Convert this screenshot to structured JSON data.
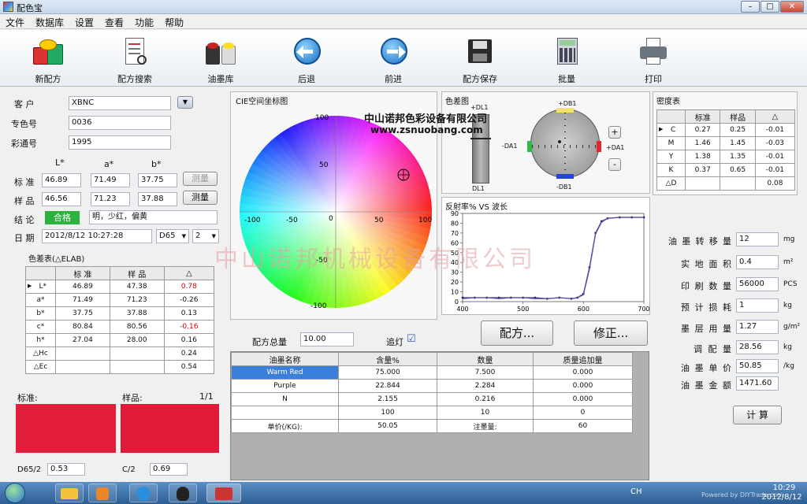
{
  "window": {
    "title": "配色宝"
  },
  "menu": [
    "文件",
    "数据库",
    "设置",
    "查看",
    "功能",
    "帮助"
  ],
  "toolbar": [
    {
      "label": "新配方",
      "icon": "paint-cans-icon"
    },
    {
      "label": "配方搜索",
      "icon": "document-search-icon"
    },
    {
      "label": "油墨库",
      "icon": "ink-library-icon"
    },
    {
      "label": "后退",
      "icon": "arrow-left-icon"
    },
    {
      "label": "前进",
      "icon": "arrow-right-icon"
    },
    {
      "label": "配方保存",
      "icon": "floppy-save-icon"
    },
    {
      "label": "批量",
      "icon": "calculator-icon"
    },
    {
      "label": "打印",
      "icon": "printer-icon"
    }
  ],
  "form": {
    "customer_label": "客 户",
    "customer": "XBNC",
    "color_no_label": "专色号",
    "color_no": "0036",
    "pantone_label": "彩通号",
    "pantone": "1995",
    "lab_headers": [
      "L*",
      "a*",
      "b*"
    ],
    "standard_label": "标 准",
    "standard": [
      "46.89",
      "71.49",
      "37.75"
    ],
    "sample_label": "样 品",
    "sample": [
      "46.56",
      "71.23",
      "37.88"
    ],
    "measure1": "测量",
    "measure2": "测量",
    "conclusion_label": "结 论",
    "conclusion_badge": "合格",
    "conclusion_text": "明，少红，偏黄",
    "date_label": "日 期",
    "date": "2012/8/12 10:27:28",
    "illuminant": "D65",
    "observer": "2"
  },
  "diff_table": {
    "title": "色差表(△ELAB)",
    "headers": [
      "",
      "标 准",
      "样 品",
      "△"
    ],
    "rows": [
      [
        "L*",
        "46.89",
        "47.38",
        "0.78"
      ],
      [
        "a*",
        "71.49",
        "71.23",
        "-0.26"
      ],
      [
        "b*",
        "37.75",
        "37.88",
        "0.13"
      ],
      [
        "c*",
        "80.84",
        "80.56",
        "-0.16"
      ],
      [
        "h*",
        "27.04",
        "28.00",
        "0.16"
      ],
      [
        "△Hc",
        "",
        "",
        "0.24"
      ],
      [
        "△Ec",
        "",
        "",
        "0.54"
      ]
    ]
  },
  "swatches": {
    "standard_label": "标准:",
    "sample_label": "样品:",
    "page": "1/1",
    "standard_color": "#e31e3c",
    "sample_color": "#e01a38",
    "bottom_left_label": "D65/2",
    "bottom_left_value": "0.53",
    "bottom_right_label": "C/2",
    "bottom_right_value": "0.69"
  },
  "cie": {
    "title": "CIE空间坐标图",
    "ticks_x": [
      "-100",
      "-50",
      "50",
      "100"
    ],
    "ticks_y": [
      "100",
      "50",
      "-50",
      "-100"
    ],
    "zero": "0"
  },
  "color_diff": {
    "title": "色差图",
    "dl_plus": "+DL1",
    "dl_minus": "DL1",
    "db_plus": "+DB1",
    "db_minus": "-DB1",
    "da_minus": "-DA1",
    "da_plus": "+DA1",
    "plus_btn": "+",
    "minus_btn": "-"
  },
  "watermark": {
    "company": "中山诺邦色彩设备有限公司",
    "url": "www.zsnuobang.com",
    "big": "中山诺邦机械设备有限公司"
  },
  "density_table": {
    "title": "密度表",
    "headers": [
      "",
      "标准",
      "样品",
      "△"
    ],
    "rows": [
      [
        "C",
        "0.27",
        "0.25",
        "-0.01"
      ],
      [
        "M",
        "1.46",
        "1.45",
        "-0.03"
      ],
      [
        "Y",
        "1.38",
        "1.35",
        "-0.01"
      ],
      [
        "K",
        "0.37",
        "0.65",
        "-0.01"
      ],
      [
        "△D",
        "",
        "",
        "0.08"
      ]
    ]
  },
  "reflect": {
    "title": "反射率% VS 波长",
    "y_ticks": [
      "0",
      "10",
      "20",
      "30",
      "40",
      "50",
      "60",
      "70",
      "80",
      "90"
    ],
    "x_ticks": [
      "400",
      "500",
      "600",
      "700"
    ]
  },
  "chart_data": {
    "type": "line",
    "title": "反射率% VS 波长",
    "xlabel": "",
    "ylabel": "",
    "xlim": [
      400,
      700
    ],
    "ylim": [
      0,
      90
    ],
    "series": [
      {
        "values": [
          [
            400,
            4
          ],
          [
            420,
            4
          ],
          [
            440,
            4
          ],
          [
            460,
            4
          ],
          [
            480,
            4
          ],
          [
            500,
            4
          ],
          [
            520,
            4
          ],
          [
            540,
            3
          ],
          [
            560,
            4
          ],
          [
            580,
            3
          ],
          [
            590,
            4
          ],
          [
            600,
            8
          ],
          [
            610,
            35
          ],
          [
            620,
            70
          ],
          [
            630,
            82
          ],
          [
            640,
            85
          ],
          [
            660,
            86
          ],
          [
            680,
            86
          ],
          [
            700,
            86
          ]
        ],
        "color": "#3a3a9a"
      },
      {
        "values": [
          [
            400,
            3
          ],
          [
            420,
            4
          ],
          [
            440,
            4
          ],
          [
            460,
            3
          ],
          [
            480,
            4
          ],
          [
            500,
            4
          ],
          [
            520,
            3
          ],
          [
            540,
            3
          ],
          [
            560,
            4
          ],
          [
            580,
            3
          ],
          [
            590,
            4
          ],
          [
            600,
            7
          ],
          [
            610,
            33
          ],
          [
            620,
            69
          ],
          [
            630,
            81
          ],
          [
            640,
            85
          ],
          [
            660,
            86
          ],
          [
            680,
            86
          ],
          [
            700,
            86
          ]
        ],
        "color": "#6a4a9a"
      }
    ]
  },
  "formula": {
    "amount_label": "配方总量",
    "amount": "10.00",
    "light_label": "追灯",
    "light_checked": "☑",
    "btn_formula": "配方...",
    "btn_correct": "修正...",
    "headers": [
      "油墨名称",
      "含量%",
      "数量",
      "质量追加量"
    ],
    "rows": [
      [
        "Warm Red",
        "75.000",
        "7.500",
        "0.000"
      ],
      [
        "Purple",
        "22.844",
        "2.284",
        "0.000"
      ],
      [
        "N",
        "2.155",
        "0.216",
        "0.000"
      ],
      [
        "",
        "100",
        "10",
        "0"
      ],
      [
        "单价(/KG):",
        "50.05",
        "注墨量:",
        "60"
      ]
    ]
  },
  "calc": {
    "rows": [
      {
        "label": "油墨转移量",
        "value": "12",
        "unit": "mg"
      },
      {
        "label": "实地面积",
        "value": "0.4",
        "unit": "m²"
      },
      {
        "label": "印刷数量",
        "value": "56000",
        "unit": "PCS"
      },
      {
        "label": "预计损耗",
        "value": "1",
        "unit": "kg"
      },
      {
        "label": "墨层用量",
        "value": "1.27",
        "unit": "g/m²"
      },
      {
        "label": "调配量",
        "value": "28.56",
        "unit": "kg"
      },
      {
        "label": "油墨单价",
        "value": "50.85",
        "unit": "/kg"
      },
      {
        "label": "油墨金额",
        "value": "1471.60",
        "unit": ""
      }
    ],
    "button": "计 算"
  },
  "taskbar": {
    "time": "10:29",
    "date": "2012/8/12",
    "lang": "CH",
    "brand": "Powered by DIYTrade.com"
  }
}
